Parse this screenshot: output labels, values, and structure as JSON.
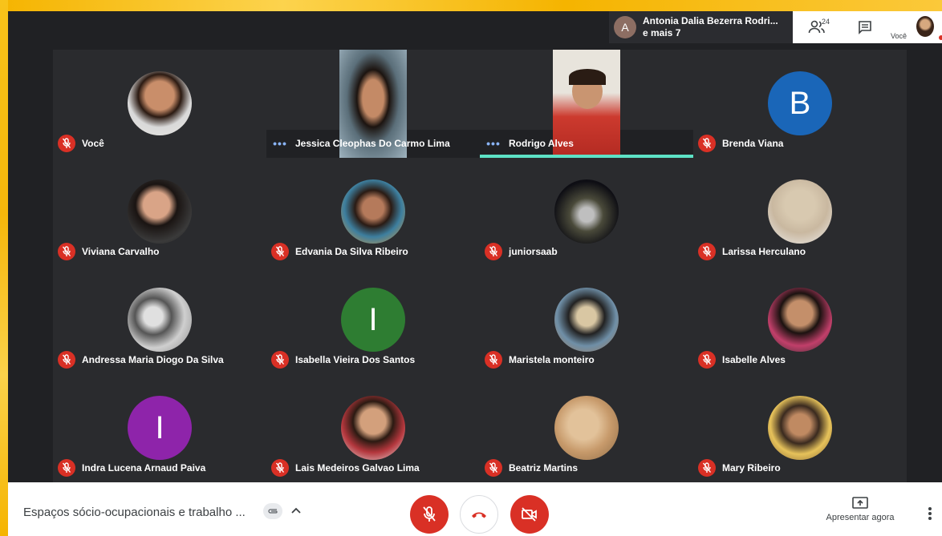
{
  "presenter": {
    "initial": "A",
    "line1": "Antonia Dalia Bezerra Rodri...",
    "line2": "e mais 7"
  },
  "topbar": {
    "people_count": "24",
    "self_label": "Você"
  },
  "participants": [
    {
      "name": "Você",
      "type": "photo",
      "status": "muted"
    },
    {
      "name": "Jessica Cleophas Do Carmo Lima",
      "type": "video",
      "status": "dots"
    },
    {
      "name": "Rodrigo Alves",
      "type": "video",
      "status": "dots",
      "speaking": true
    },
    {
      "name": "Brenda Viana",
      "type": "letter",
      "initial": "B",
      "color": "#1a66b8",
      "status": "muted"
    },
    {
      "name": "Viviana Carvalho",
      "type": "photo",
      "status": "muted"
    },
    {
      "name": "Edvania Da Silva Ribeiro",
      "type": "photo",
      "status": "muted"
    },
    {
      "name": "juniorsaab",
      "type": "photo",
      "status": "muted"
    },
    {
      "name": "Larissa Herculano",
      "type": "photo",
      "status": "muted"
    },
    {
      "name": "Andressa Maria Diogo Da Silva",
      "type": "photo",
      "status": "muted"
    },
    {
      "name": "Isabella Vieira Dos Santos",
      "type": "letter",
      "initial": "I",
      "color": "#2e7d32",
      "status": "muted"
    },
    {
      "name": "Maristela monteiro",
      "type": "photo",
      "status": "muted"
    },
    {
      "name": "Isabelle Alves",
      "type": "photo",
      "status": "muted"
    },
    {
      "name": "Indra Lucena Arnaud Paiva",
      "type": "letter",
      "initial": "I",
      "color": "#8e24aa",
      "status": "muted"
    },
    {
      "name": "Lais Medeiros Galvao Lima",
      "type": "photo",
      "status": "muted"
    },
    {
      "name": "Beatriz Martins",
      "type": "photo",
      "status": "muted"
    },
    {
      "name": "Mary Ribeiro",
      "type": "photo",
      "status": "muted"
    }
  ],
  "bottombar": {
    "meeting_title": "Espaços sócio-ocupacionais e trabalho ...",
    "present_label": "Apresentar agora"
  },
  "colors": {
    "accent_red": "#d93025",
    "speaking": "#5de2c6",
    "frame": "#f5b800"
  }
}
